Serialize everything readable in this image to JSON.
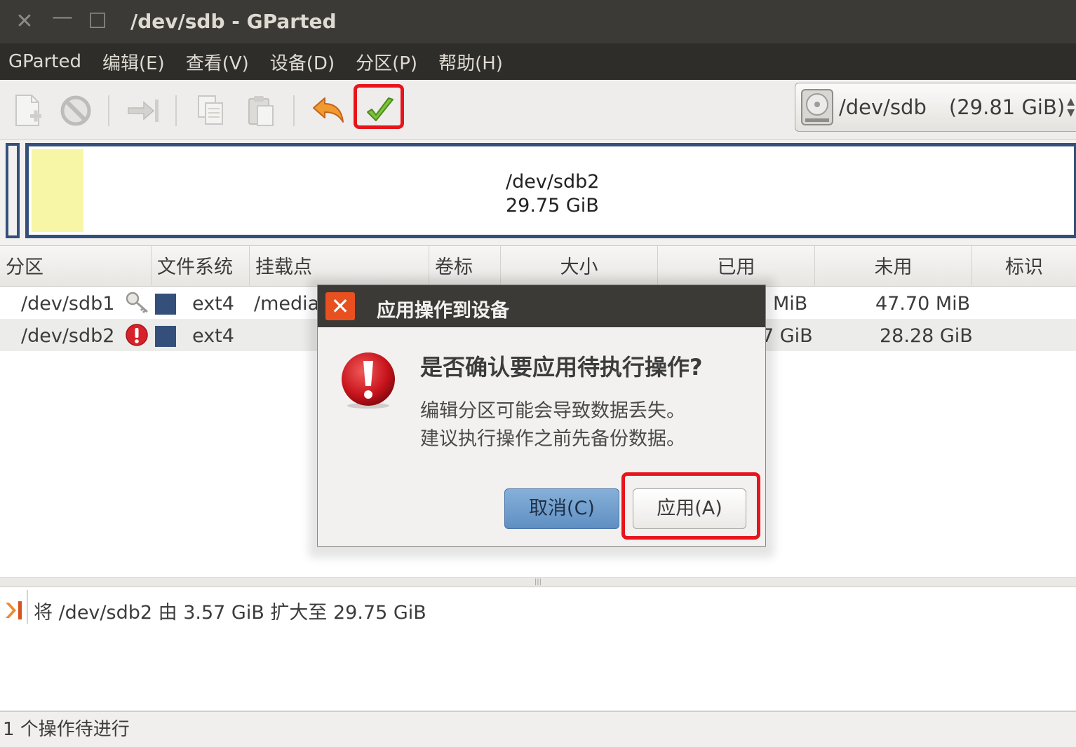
{
  "window": {
    "title": "/dev/sdb - GParted",
    "close_glyph": "✕",
    "minimize_glyph": "—",
    "maximize_glyph": "☐"
  },
  "menubar": {
    "items": [
      "GParted",
      "编辑(E)",
      "查看(V)",
      "设备(D)",
      "分区(P)",
      "帮助(H)"
    ]
  },
  "toolbar": {
    "buttons": [
      {
        "name": "new-partition",
        "icon": "new-document-icon",
        "enabled": false
      },
      {
        "name": "delete-partition",
        "icon": "delete-circle-icon",
        "enabled": false
      },
      {
        "name": "resize-move",
        "icon": "resize-arrow-icon",
        "enabled": false
      },
      {
        "name": "copy",
        "icon": "copy-icon",
        "enabled": false
      },
      {
        "name": "paste",
        "icon": "paste-icon",
        "enabled": false
      },
      {
        "name": "undo",
        "icon": "undo-arrow-icon",
        "enabled": true
      },
      {
        "name": "apply",
        "icon": "checkmark-icon",
        "enabled": true,
        "highlighted": true
      }
    ],
    "device_selector": {
      "device": "/dev/sdb",
      "size": "(29.81 GiB)"
    }
  },
  "diskmap": {
    "partition_name": "/dev/sdb2",
    "partition_size": "29.75 GiB",
    "used_fraction": 0.05
  },
  "table": {
    "headers": [
      "分区",
      "文件系统",
      "挂载点",
      "卷标",
      "大小",
      "已用",
      "未用",
      "标识"
    ],
    "rows": [
      {
        "partition": "/dev/sdb1",
        "status_icon": "key-icon",
        "filesystem": "ext4",
        "mountpoint": "/media",
        "used": "MiB",
        "unused": "47.70 MiB"
      },
      {
        "partition": "/dev/sdb2",
        "status_icon": "error-icon",
        "filesystem": "ext4",
        "mountpoint": "",
        "used": "7 GiB",
        "unused": "28.28 GiB"
      }
    ]
  },
  "operations": {
    "items": [
      "将 /dev/sdb2 由 3.57 GiB 扩大至 29.75 GiB"
    ]
  },
  "status": {
    "text": "1 个操作待进行"
  },
  "dialog": {
    "title": "应用操作到设备",
    "heading": "是否确认要应用待执行操作?",
    "body_line1": "编辑分区可能会导致数据丢失。",
    "body_line2": "建议执行操作之前先备份数据。",
    "cancel_label": "取消(C)",
    "apply_label": "应用(A)",
    "close_glyph": "✕"
  },
  "colors": {
    "partition_ext4": "#34507a",
    "used_space": "#f6f6a6",
    "highlight": "#e8141b",
    "dialog_close": "#e8501f"
  }
}
